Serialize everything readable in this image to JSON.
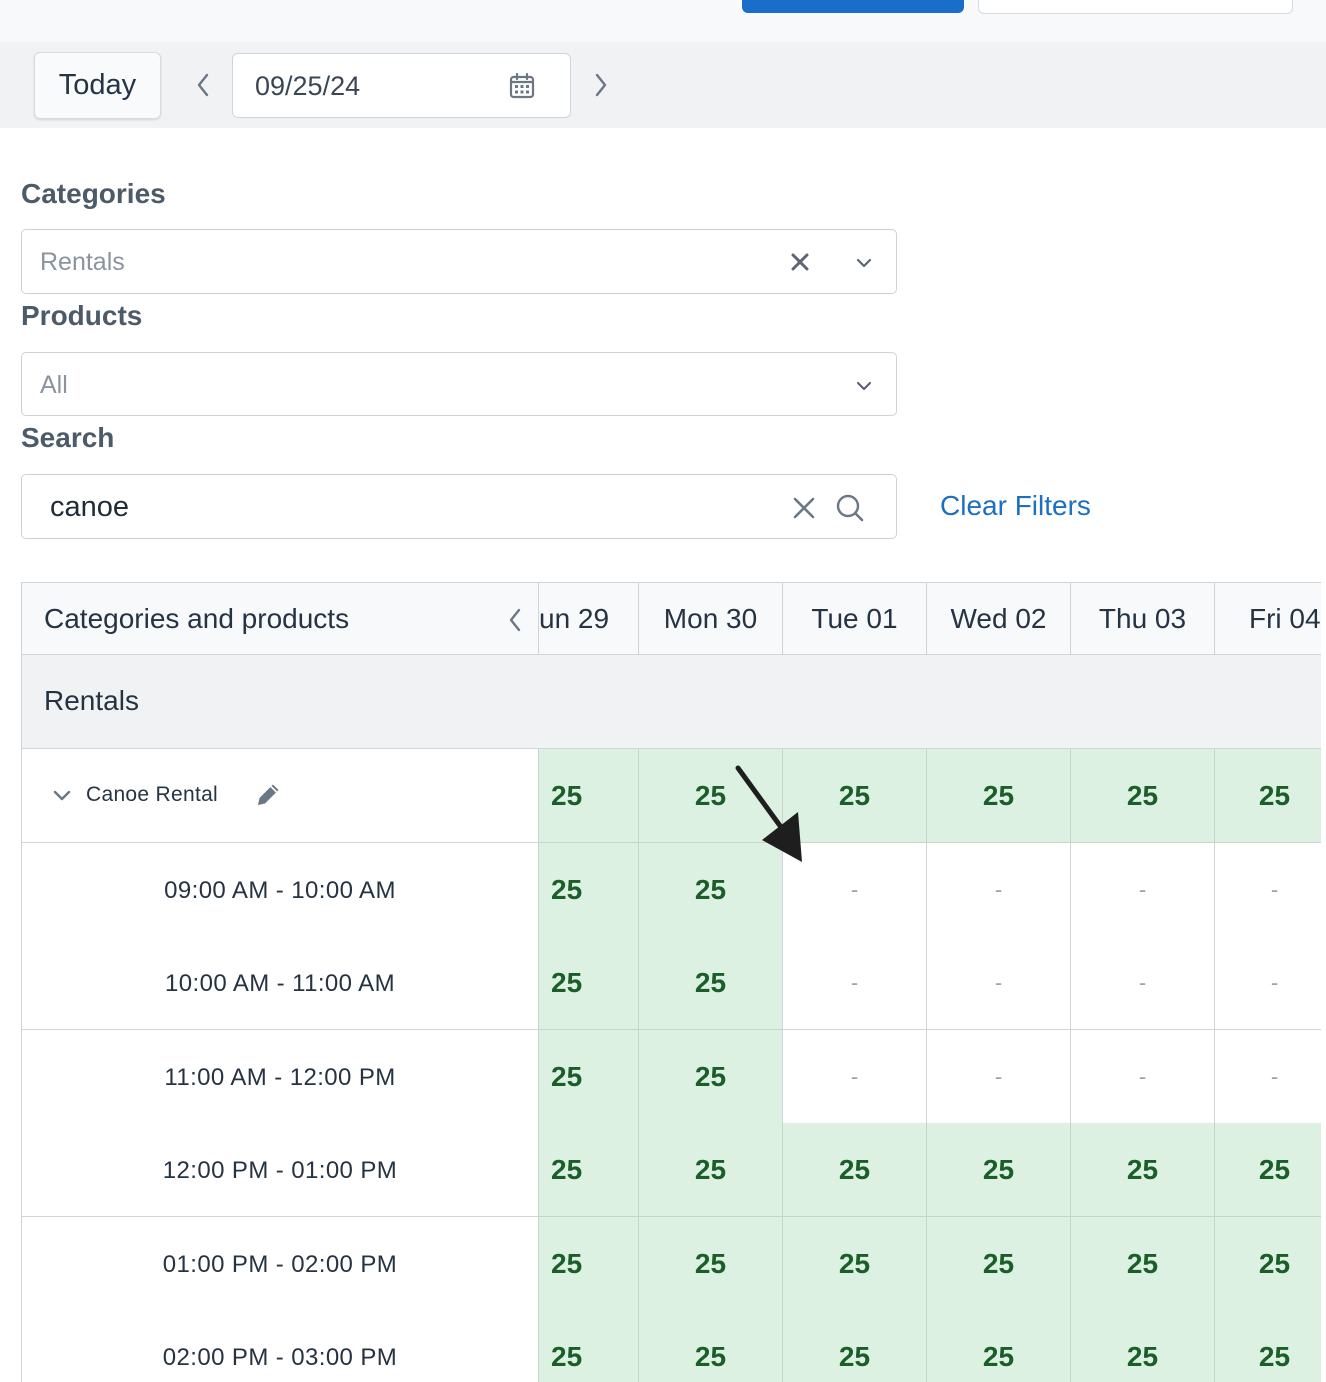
{
  "toolbar": {
    "today_label": "Today",
    "date_value": "09/25/24"
  },
  "filters": {
    "categories": {
      "label": "Categories",
      "value": "Rentals"
    },
    "products": {
      "label": "Products",
      "value": "All"
    },
    "search": {
      "label": "Search",
      "value": "canoe"
    },
    "clear_label": "Clear Filters"
  },
  "grid": {
    "header_label": "Categories and products",
    "days": [
      "un 29",
      "Mon 30",
      "Tue 01",
      "Wed 02",
      "Thu 03",
      "Fri 04"
    ],
    "category": "Rentals",
    "product": {
      "name": "Canoe Rental",
      "values": [
        "25",
        "25",
        "25",
        "25",
        "25",
        "25"
      ]
    },
    "slots": [
      {
        "label": "09:00 AM - 10:00 AM",
        "values": [
          "25",
          "25",
          "-",
          "-",
          "-",
          "-"
        ]
      },
      {
        "label": "10:00 AM - 11:00 AM",
        "values": [
          "25",
          "25",
          "-",
          "-",
          "-",
          "-"
        ]
      },
      {
        "label": "11:00 AM - 12:00 PM",
        "values": [
          "25",
          "25",
          "-",
          "-",
          "-",
          "-"
        ]
      },
      {
        "label": "12:00 PM - 01:00 PM",
        "values": [
          "25",
          "25",
          "25",
          "25",
          "25",
          "25"
        ]
      },
      {
        "label": "01:00 PM - 02:00 PM",
        "values": [
          "25",
          "25",
          "25",
          "25",
          "25",
          "25"
        ]
      },
      {
        "label": "02:00 PM - 03:00 PM",
        "values": [
          "25",
          "25",
          "25",
          "25",
          "25",
          "25"
        ]
      }
    ]
  },
  "colors": {
    "accent": "#1a6dc8",
    "available_bg": "#dcf1e2",
    "available_text": "#1b5e2a"
  }
}
